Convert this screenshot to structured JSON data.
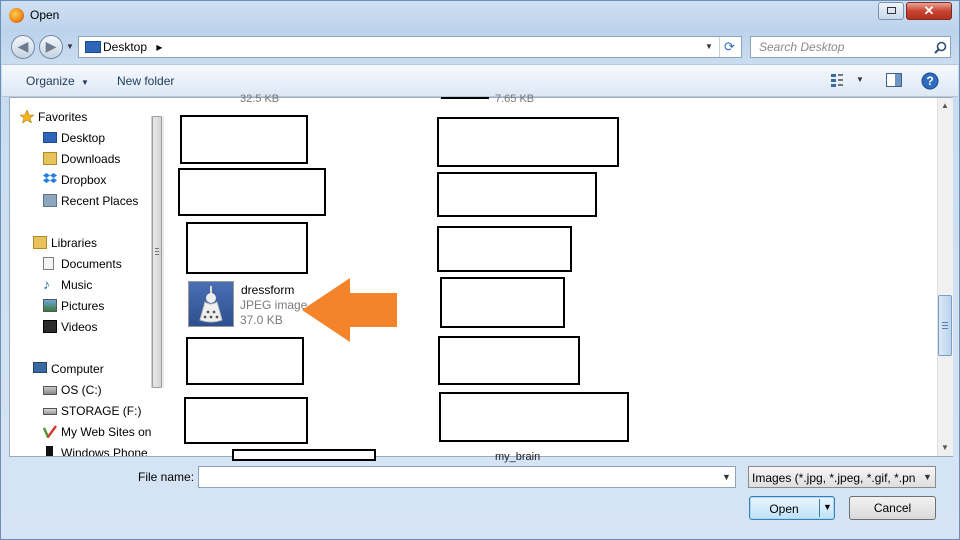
{
  "window": {
    "title": "Open"
  },
  "nav": {
    "back_glyph": "◀",
    "forward_glyph": "▶",
    "address_path": "Desktop",
    "address_separator": "▸",
    "search_placeholder": "Search Desktop"
  },
  "toolbar": {
    "organize_label": "Organize",
    "new_folder_label": "New folder"
  },
  "sidebar": {
    "favorites_label": "Favorites",
    "favorites": [
      "Desktop",
      "Downloads",
      "Dropbox",
      "Recent Places"
    ],
    "libraries_label": "Libraries",
    "libraries": [
      "Documents",
      "Music",
      "Pictures",
      "Videos"
    ],
    "computer_label": "Computer",
    "computer": [
      "OS (C:)",
      "STORAGE (F:)",
      "My Web Sites on",
      "Windows Phone"
    ]
  },
  "files": {
    "partial_top_left": "32.5 KB",
    "partial_top_right": "7.65 KB",
    "highlighted": {
      "name": "dressform",
      "type": "JPEG image",
      "size": "37.0 KB"
    },
    "partial_bottom_right": "my_brain",
    "annotation_color": "#f5832a"
  },
  "bottom": {
    "file_name_label": "File name:",
    "file_name_value": "",
    "filter_label": "Images (*.jpg, *.jpeg, *.gif, *.pn",
    "open_label": "Open",
    "cancel_label": "Cancel"
  }
}
